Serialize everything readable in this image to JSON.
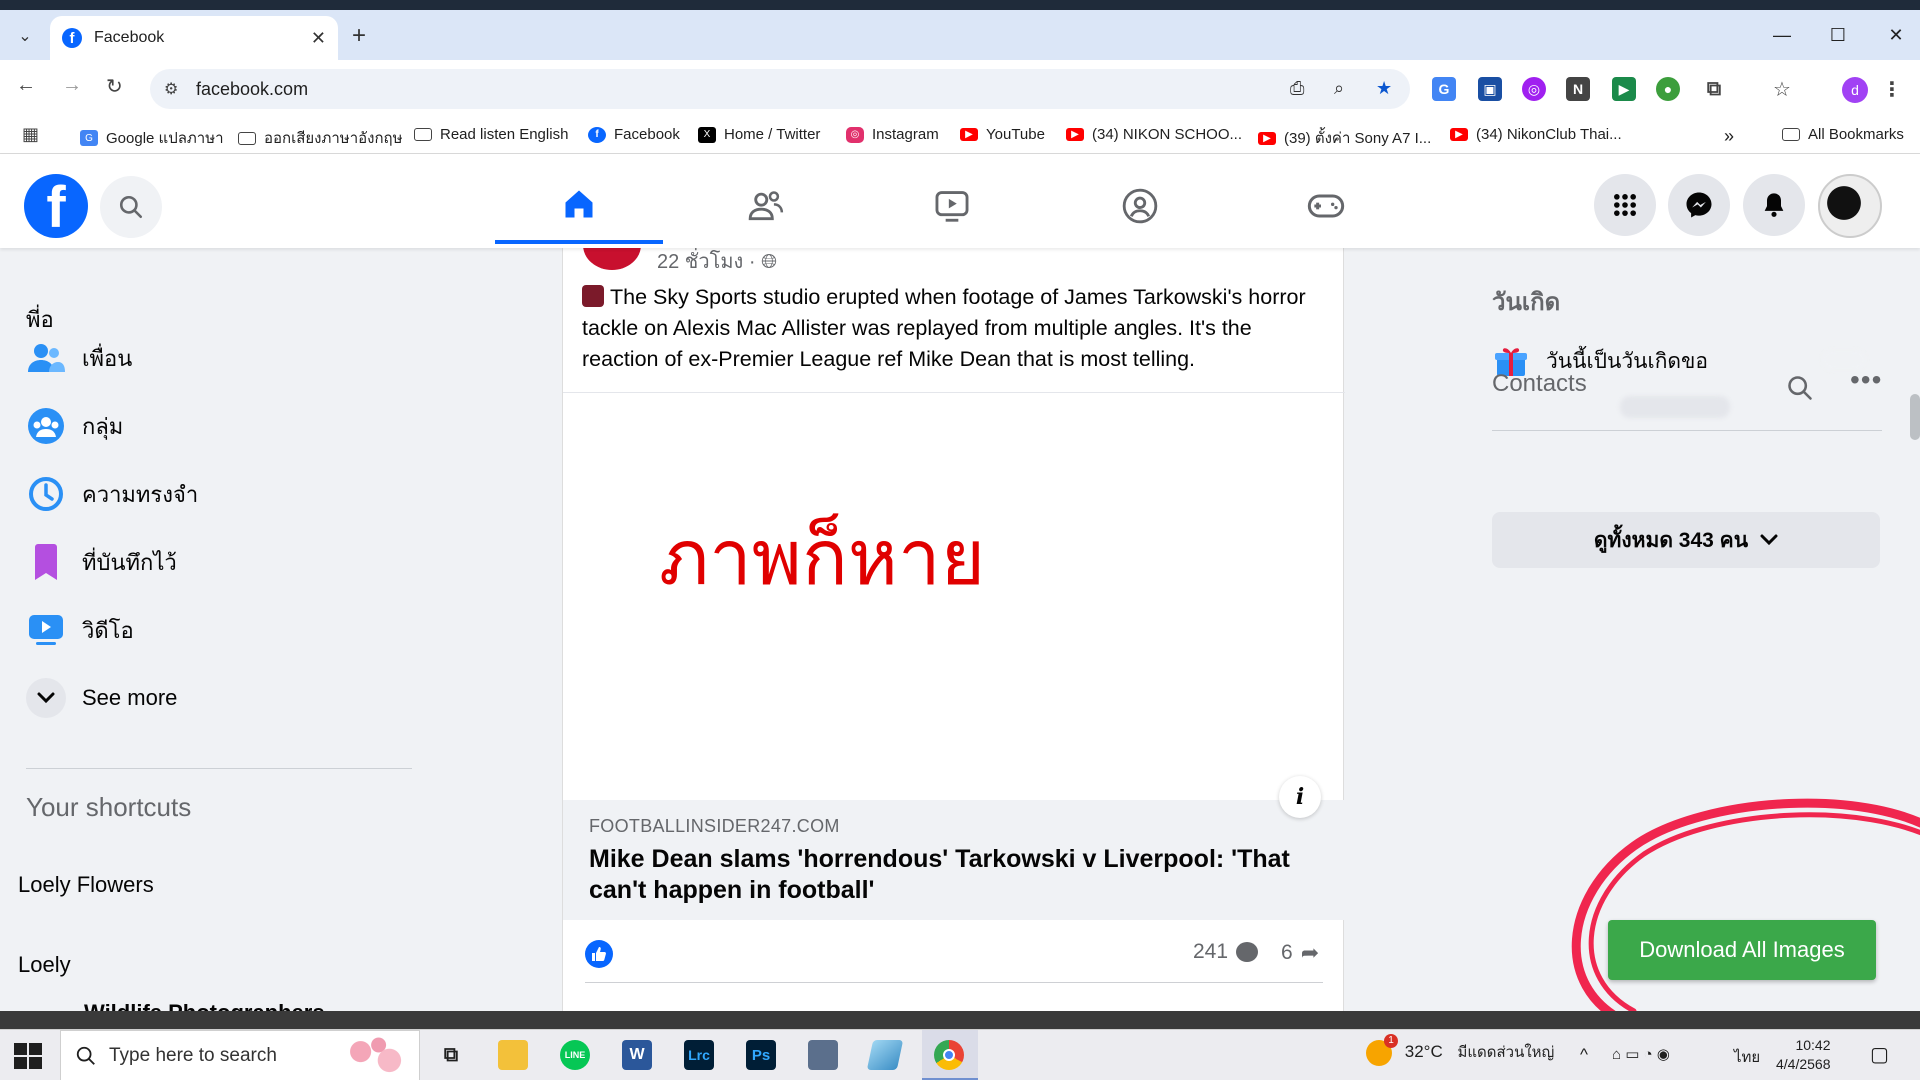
{
  "browser": {
    "tab_title": "Facebook",
    "url": "facebook.com",
    "profile_letter": "d"
  },
  "bookmarks": [
    {
      "label": "Google แปลภาษา",
      "icon": "google-translate-icon"
    },
    {
      "label": "ออกเสียงภาษาอังกฤษ",
      "icon": "folder-icon"
    },
    {
      "label": "Read listen English",
      "icon": "folder-icon"
    },
    {
      "label": "Facebook",
      "icon": "facebook-icon"
    },
    {
      "label": "Home / Twitter",
      "icon": "x-icon"
    },
    {
      "label": "Instagram",
      "icon": "instagram-icon"
    },
    {
      "label": "YouTube",
      "icon": "youtube-icon"
    },
    {
      "label": "(34) NIKON SCHOO...",
      "icon": "youtube-icon"
    },
    {
      "label": "(39) ตั้งค่า Sony A7 I...",
      "icon": "youtube-icon"
    },
    {
      "label": "(34) NikonClub Thai...",
      "icon": "youtube-icon"
    }
  ],
  "bookmarks_all": "All Bookmarks",
  "sidebar": {
    "header": "พี่อ",
    "items": [
      {
        "label": "เพื่อน",
        "icon": "friends-icon"
      },
      {
        "label": "กลุ่ม",
        "icon": "groups-icon"
      },
      {
        "label": "ความทรงจำ",
        "icon": "memories-icon"
      },
      {
        "label": "ที่บันทึกไว้",
        "icon": "saved-icon"
      },
      {
        "label": "วิดีโอ",
        "icon": "video-icon"
      }
    ],
    "see_more": "See more",
    "shortcuts_title": "Your shortcuts",
    "shortcuts": [
      "Loely Flowers",
      "Loely",
      "Wildlife Photographers"
    ]
  },
  "post": {
    "time": "22 ชั่วโมง ·",
    "text": "The Sky Sports studio erupted when footage of James Tarkowski's horror tackle on Alexis Mac Allister was replayed from multiple angles. It's the reaction of ex-Premier League ref Mike Dean that is most telling.",
    "missing_image_note": "ภาพก็หาย",
    "link_domain": "FOOTBALLINSIDER247.COM",
    "link_title": "Mike Dean slams 'horrendous' Tarkowski v Liverpool: 'That can't happen in football'",
    "comments_count": "241",
    "shares_count": "6"
  },
  "right": {
    "birthdays_title": "วันเกิด",
    "birthday_text": "วันนี้เป็นวันเกิดขอ",
    "contacts_title": "Contacts",
    "see_all": "ดูทั้งหมด 343 คน"
  },
  "download_button": "Download All Images",
  "taskbar": {
    "search_placeholder": "Type here to search",
    "weather": "32°C",
    "weather_location": "มีแดดส่วนใหญ่",
    "language": "ไทย",
    "time": "10:42",
    "date": "4/4/2568",
    "weather_badge": "1",
    "apps": [
      {
        "name": "task-view",
        "label": ""
      },
      {
        "name": "file-explorer",
        "label": ""
      },
      {
        "name": "line",
        "label": "LINE"
      },
      {
        "name": "word",
        "label": "W"
      },
      {
        "name": "lightroom-classic",
        "label": "Lrc"
      },
      {
        "name": "photoshop",
        "label": "Ps"
      },
      {
        "name": "calculator",
        "label": ""
      },
      {
        "name": "app-blue",
        "label": ""
      },
      {
        "name": "chrome",
        "label": ""
      }
    ]
  },
  "colors": {
    "facebook_blue": "#0866ff",
    "download_green": "#3ba84a",
    "annotation_red": "#e00000",
    "annotation_circle": "#f0264e"
  }
}
